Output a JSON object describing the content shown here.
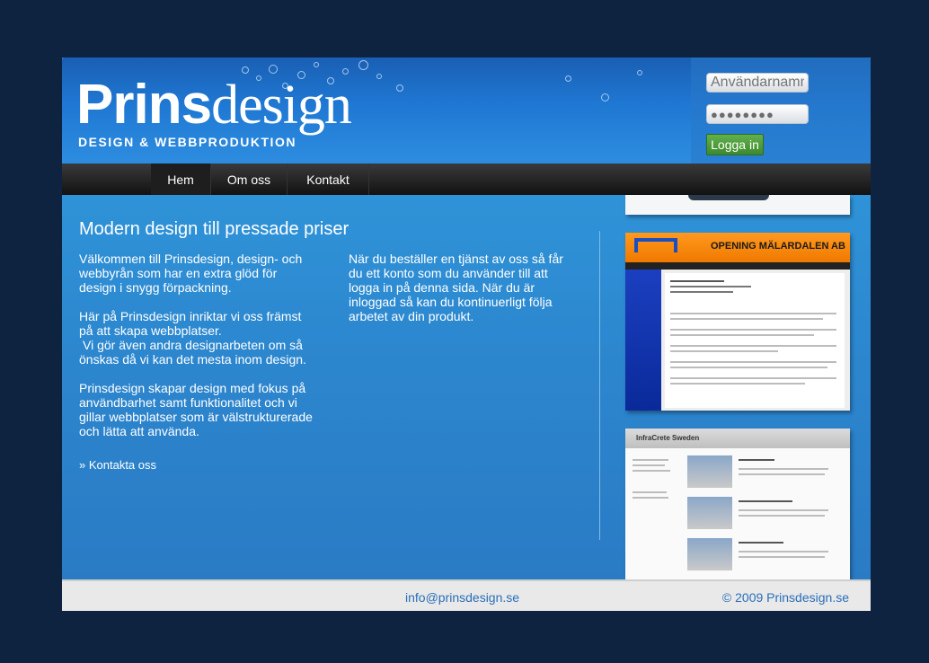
{
  "brand": {
    "name_bold": "Prins",
    "name_light": "design",
    "tagline": "DESIGN & WEBBPRODUKTION"
  },
  "login": {
    "username_placeholder": "Användarnamn",
    "password_mask": "●●●●●●●●",
    "submit_label": "Logga in"
  },
  "nav": {
    "items": [
      "Hem",
      "Om oss",
      "Kontakt"
    ],
    "active": "Hem"
  },
  "main": {
    "headline": "Modern design till pressade priser",
    "col1": [
      "Välkommen till Prinsdesign, design- och webbyrån som har en extra glöd för design i snygg förpackning.",
      "Här på Prinsdesign inriktar vi oss främst på att skapa webbplatser.",
      "Vi gör även andra designarbeten om så önskas då vi kan det mesta inom design.",
      "Prinsdesign skapar design med fokus på användbarhet samt funktionalitet och vi gillar webbplatser som är välstrukturerade och lätta att använda."
    ],
    "col2": "När du beställer en tjänst av oss så får du ett konto som du använder till att logga in på denna sida. När du är inloggad så kan du kontinuerligt följa arbetet av din produkt.",
    "contact_link": "» Kontakta oss"
  },
  "portfolio": {
    "shot1_title": "OPENING MÄLARDALEN AB",
    "shot2_title": "InfraCrete Sweden"
  },
  "footer": {
    "email": "info@prinsdesign.se",
    "copyright": "© 2009 Prinsdesign.se"
  }
}
